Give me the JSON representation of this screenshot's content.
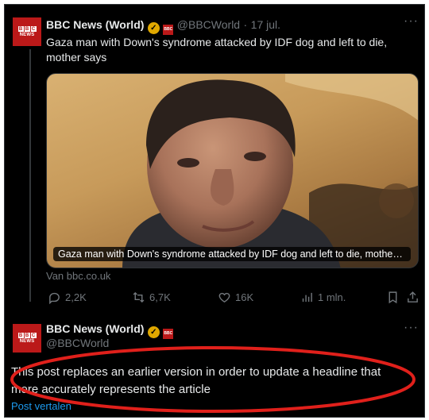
{
  "tweet1": {
    "author_name": "BBC News (World)",
    "handle": "@BBCWorld",
    "separator": "·",
    "date": "17 jul.",
    "text": "Gaza man with Down's syndrome attacked by IDF dog and left to die, mother says",
    "media_caption": "Gaza man with Down's syndrome attacked by IDF dog and left to die, mother s...",
    "source": "Van bbc.co.uk",
    "actions": {
      "replies": "2,2K",
      "reposts": "6,7K",
      "likes": "16K",
      "views": "1 mln."
    }
  },
  "tweet2": {
    "author_name": "BBC News (World)",
    "handle": "@BBCWorld",
    "text": "This post replaces an earlier version in order to update a headline that more accurately represents the article",
    "translate_link": "Post vertalen"
  },
  "avatar": {
    "letters": [
      "B",
      "B",
      "C"
    ],
    "word": "NEWS"
  },
  "icons": {
    "verified": "verified-gold-badge-icon",
    "affiliate": "bbc-affiliate-badge-icon",
    "more": "more-dots-icon",
    "reply": "reply-icon",
    "repost": "repost-icon",
    "like": "heart-icon",
    "views": "views-bar-chart-icon",
    "bookmark": "bookmark-icon",
    "share": "share-icon"
  },
  "colors": {
    "background": "#000000",
    "primary_text": "#e7e9ea",
    "muted_text": "#71767b",
    "link": "#1d9bf0",
    "bbc_red": "#bb1919",
    "verified_gold": "#e0a800",
    "annotation_red": "#e0201b"
  }
}
